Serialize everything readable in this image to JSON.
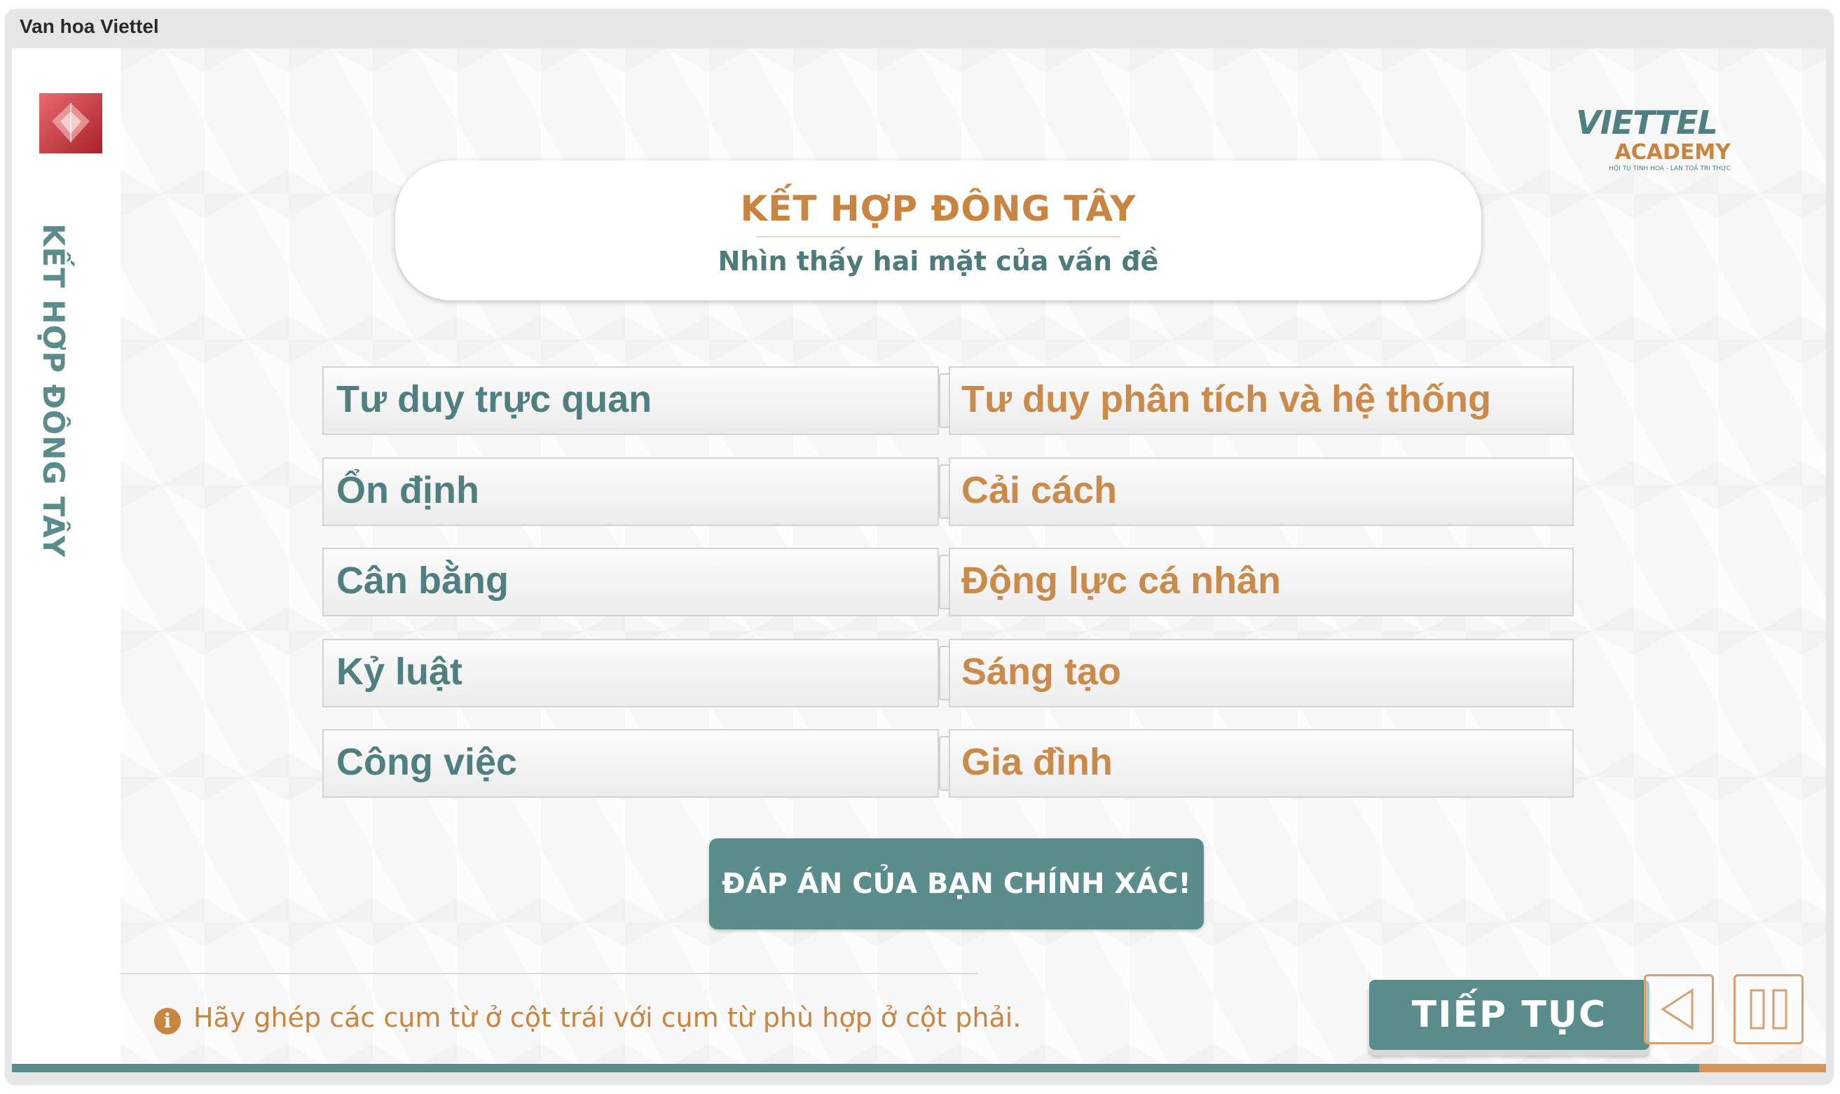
{
  "window": {
    "title": "Van hoa Viettel"
  },
  "sidebar": {
    "title": "KẾT HỢP ĐÔNG TÂY"
  },
  "brand": {
    "wordmark": "VIETTEL",
    "sub": "ACADEMY",
    "tagline": "HỘI TỤ TINH HOA - LAN TOẢ TRI THỨC"
  },
  "header": {
    "title": "KẾT HỢP ĐÔNG TÂY",
    "subtitle": "Nhìn thấy hai mặt của vấn đề"
  },
  "pairs": [
    {
      "left": "Tư duy trực quan",
      "right": "Tư duy phân tích và hệ thống"
    },
    {
      "left": "Ổn định",
      "right": "Cải cách"
    },
    {
      "left": "Cân bằng",
      "right": "Động lực cá nhân"
    },
    {
      "left": "Kỷ luật",
      "right": "Sáng tạo"
    },
    {
      "left": "Công việc",
      "right": "Gia đình"
    }
  ],
  "feedback": {
    "label": "ĐÁP ÁN CỦA BẠN CHÍNH XÁC!"
  },
  "footer": {
    "instruction": "Hãy ghép các cụm từ ở cột trái với cụm từ phù hợp ở cột phải.",
    "continue_label": "TIẾP TỤC"
  },
  "icons": {
    "info": "info-icon",
    "prev": "triangle-left-icon",
    "pause": "pause-icon"
  },
  "colors": {
    "teal": "#5a8c8c",
    "orange": "#c9843f",
    "brand_red": "#c8333a"
  },
  "progress": {
    "fraction": 0.93
  }
}
